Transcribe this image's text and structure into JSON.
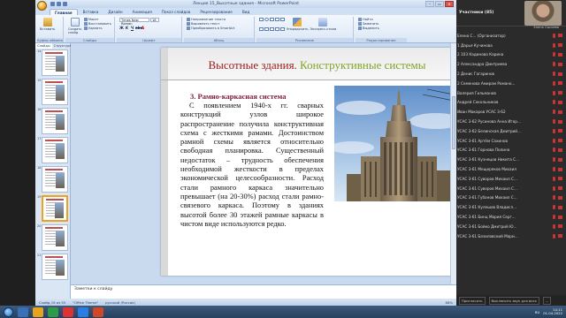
{
  "window": {
    "title": "Лекция 15_Высотные здания - Microsoft PowerPoint",
    "controls": [
      "–",
      "▭",
      "✕"
    ]
  },
  "ribbon": {
    "tabs": [
      "Главная",
      "Вставка",
      "Дизайн",
      "Анимация",
      "Показ слайдов",
      "Рецензирование",
      "Вид"
    ],
    "active_tab": "Главная",
    "clipboard": {
      "name": "Буфер обмена",
      "paste": "Вставить"
    },
    "slides": {
      "name": "Слайды",
      "create": "Создать слайд",
      "layout": "Макет",
      "restore": "Восстановить",
      "delete": "Удалить"
    },
    "font": {
      "name": "Шрифт",
      "font_family": "Times New Roman",
      "font_size": "18"
    },
    "paragraph": {
      "name": "Абзац",
      "direction": "Направление текста",
      "align": "Выровнять текст",
      "smartart": "Преобразовать в SmartArt"
    },
    "drawing": {
      "name": "Рисование",
      "arrange": "Упорядочить",
      "styles": "Экспресс-стили"
    },
    "editing": {
      "name": "Редактирование",
      "find": "Найти",
      "replace": "Заменить",
      "select": "Выделить"
    }
  },
  "left_panel": {
    "tabs": [
      "Слайды",
      "Структура"
    ],
    "slides": [
      "14",
      "15",
      "16",
      "17",
      "18",
      "19",
      "20",
      "21"
    ],
    "selected_index": 5
  },
  "slide": {
    "title_part1": "Высотные здания.",
    "title_part2": "Конструктивные системы",
    "subtitle": "3. Рамно-каркасная система",
    "body": "С появлением 1940-х гг. сварных конструкций узлов широкое распространение получила конструктивная схема с жесткими рамами. Достоинством рамной схемы является относительно свободная планировка. Существенный недостаток – трудность обеспечения необходимой жесткости в пределах экономической целесообразности. Расход стали рамного каркаса значительно превышает (на 20-30%) расход стали рамно-связевого каркаса. Поэтому в зданиях высотой более 30 этажей рамные каркасы в чистом виде используются редко."
  },
  "notes": {
    "placeholder": "Заметки к слайду"
  },
  "status": {
    "slide": "Слайд 19 из 55",
    "theme": "\"Office Theme\"",
    "language": "русский (Россия)",
    "zoom": "68%"
  },
  "participants": {
    "title": "Участники (85)",
    "camera_name": "Елена Сысоева",
    "list": [
      "Елена С... (Организатор)",
      "1 Дарья Кучинова",
      "2 103 Кадинова Карина",
      "2 Александра Дмитриева",
      "2 Денис Гагаринов",
      "2 Семенова Амирам Романо...",
      "Валерия Гильманов",
      "Андрей Сокольников",
      "Иван Макаров УСАС 3-62",
      "УСАС 3-62 Русинова Анна Игор...",
      "УСАС 3-62 Белинская Дмитрий...",
      "УСАС 3-61 Артём Сахинов",
      "УСАС 3-61 Горнова Полина",
      "УСАС 3-61 Кузнецов Никита С...",
      "УСАС 3-61 Мещеряков Михаил",
      "УСАС 3-61 Суворов Михаил С...",
      "УСАС 3-61 Суворов Михаил С...",
      "УСАС 3-61 Губанов Михаил С...",
      "УСАС 3-61 Кулешов Владисл...",
      "УСАС 3-61 Бинц Мария Серг...",
      "УСАС 3-61 Бойко Дмитрий Ю...",
      "УСАС 3-61 Базиловский Мари..."
    ],
    "footer": [
      "Пригласить",
      "Выключить звук для всех",
      "..."
    ]
  },
  "taskbar": {
    "time": "14:11",
    "date": "01.04.2022",
    "lang": "RU"
  }
}
